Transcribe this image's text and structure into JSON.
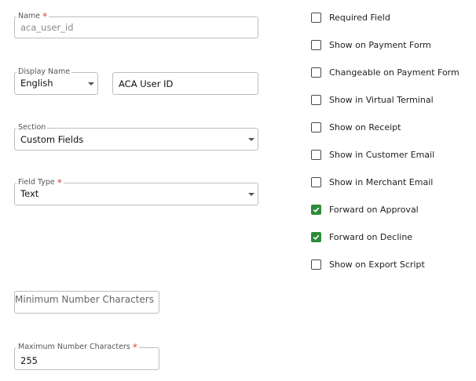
{
  "form": {
    "name": {
      "label": "Name",
      "required_mark": "*",
      "value": "aca_user_id"
    },
    "display_name": {
      "label": "Display Name",
      "language": "English",
      "value": "ACA User ID"
    },
    "section": {
      "label": "Section",
      "value": "Custom Fields"
    },
    "field_type": {
      "label": "Field Type",
      "required_mark": "*",
      "value": "Text"
    },
    "min_chars": {
      "placeholder": "Minimum Number Characters"
    },
    "max_chars": {
      "label": "Maximum Number Characters",
      "required_mark": "*",
      "value": "255"
    }
  },
  "options": [
    {
      "label": "Required Field",
      "checked": false
    },
    {
      "label": "Show on Payment Form",
      "checked": false
    },
    {
      "label": "Changeable on Payment Form",
      "checked": false
    },
    {
      "label": "Show in Virtual Terminal",
      "checked": false
    },
    {
      "label": "Show on Receipt",
      "checked": false
    },
    {
      "label": "Show in Customer Email",
      "checked": false
    },
    {
      "label": "Show in Merchant Email",
      "checked": false
    },
    {
      "label": "Forward on Approval",
      "checked": true
    },
    {
      "label": "Forward on Decline",
      "checked": true
    },
    {
      "label": "Show on Export Script",
      "checked": false
    }
  ],
  "colors": {
    "checked": "#2e8b3a",
    "required": "#e53935",
    "border": "#bdbdbd"
  },
  "icons": {
    "checkmark": "check-icon",
    "dropdown": "chevron-down-icon"
  }
}
